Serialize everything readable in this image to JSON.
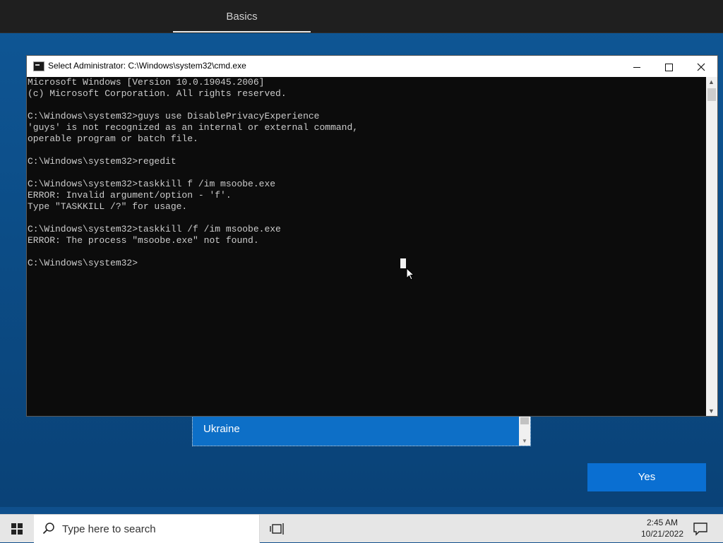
{
  "oobe": {
    "tab_label": "Basics",
    "region_selected": "Ukraine",
    "yes_label": "Yes"
  },
  "cmd": {
    "title": "Select Administrator: C:\\Windows\\system32\\cmd.exe",
    "lines": [
      "Microsoft Windows [Version 10.0.19045.2006]",
      "(c) Microsoft Corporation. All rights reserved.",
      "",
      "C:\\Windows\\system32>guys use DisablePrivacyExperience",
      "'guys' is not recognized as an internal or external command,",
      "operable program or batch file.",
      "",
      "C:\\Windows\\system32>regedit",
      "",
      "C:\\Windows\\system32>taskkill f /im msoobe.exe",
      "ERROR: Invalid argument/option - 'f'.",
      "Type \"TASKKILL /?\" for usage.",
      "",
      "C:\\Windows\\system32>taskkill /f /im msoobe.exe",
      "ERROR: The process \"msoobe.exe\" not found.",
      "",
      "C:\\Windows\\system32>"
    ]
  },
  "taskbar": {
    "search_placeholder": "Type here to search",
    "time": "2:45 AM",
    "date": "10/21/2022"
  },
  "icons": {
    "start": "windows-logo-icon",
    "search": "search-icon",
    "taskview": "task-view-icon",
    "notifications": "notification-icon",
    "cmd": "cmd-icon"
  },
  "colors": {
    "oobe_bg": "#0c4d87",
    "accent": "#0a6fd2",
    "console_bg": "#0c0c0c",
    "console_text": "#cccccc"
  }
}
